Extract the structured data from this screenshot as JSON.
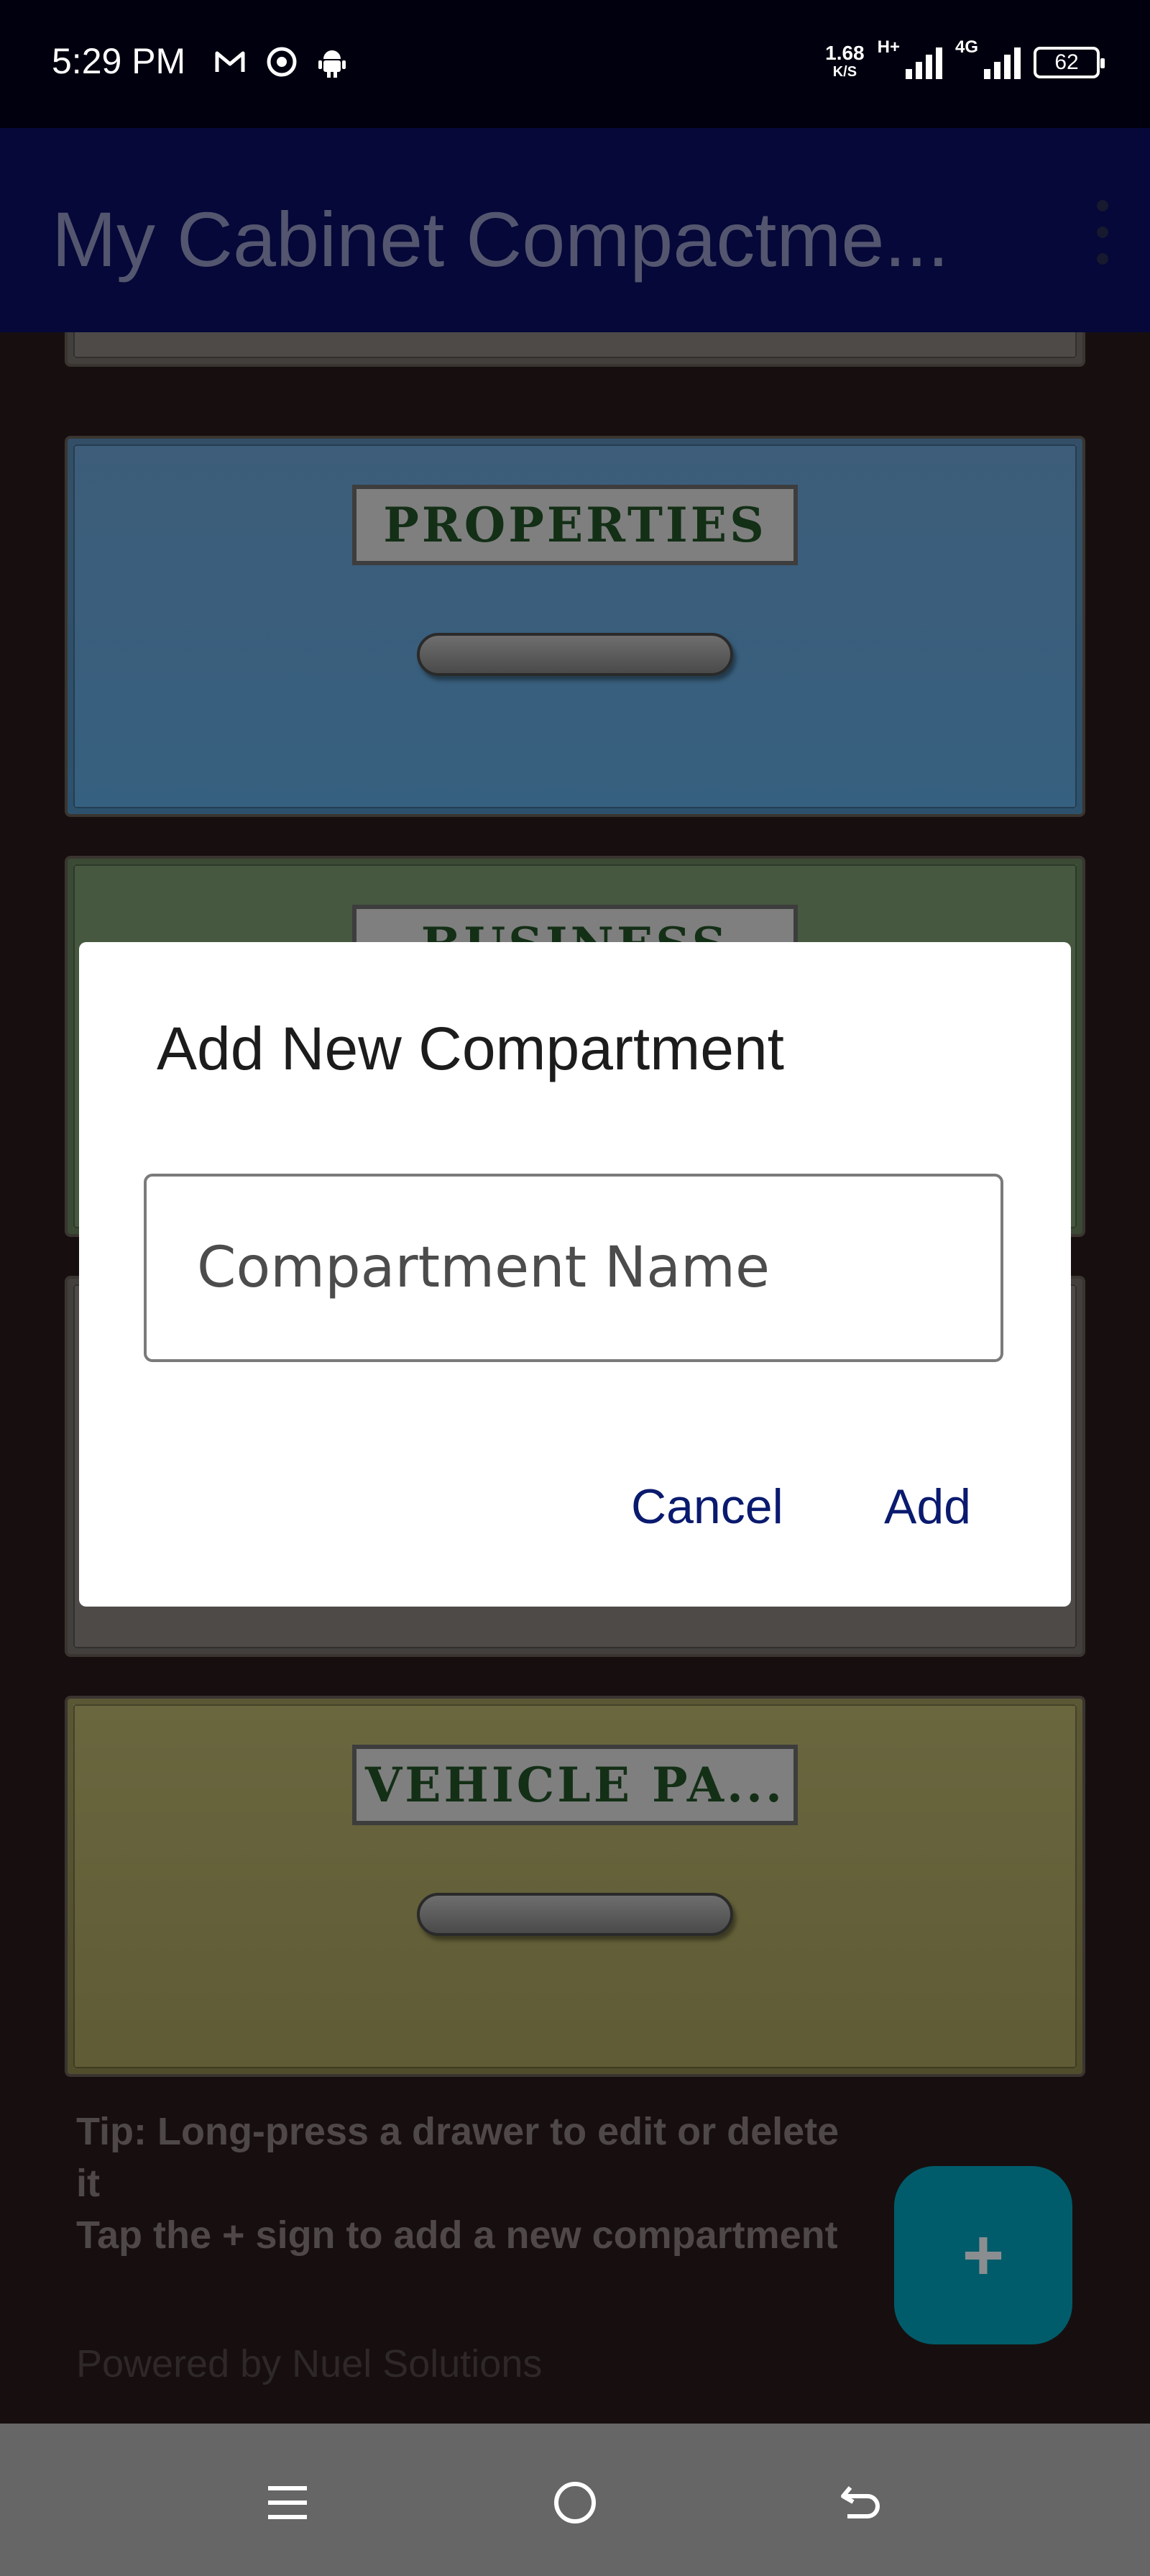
{
  "status_bar": {
    "time": "5:29 PM",
    "icons": [
      "gmail-icon",
      "chrome-icon",
      "android-icon"
    ],
    "net_speed": "1.68",
    "net_speed_unit": "K/S",
    "signal_1_label": "H+",
    "signal_2_label": "4G",
    "battery": "62"
  },
  "app_bar": {
    "title": "My Cabinet Compactme...",
    "overflow_icon": "more-vert-icon"
  },
  "drawers": [
    {
      "label": "",
      "color": "#6a6a6a"
    },
    {
      "label": "PROPERTIES",
      "color": "#4a7fae"
    },
    {
      "label": "BUSINESS",
      "color": "#5c7a58"
    },
    {
      "label": "",
      "color": "#6a6a6a"
    },
    {
      "label": "VEHICLE PA...",
      "color": "#8a8444"
    }
  ],
  "tips": {
    "line1": "Tip: Long-press a drawer to edit or delete it",
    "line2": "Tap the + sign to add a new compartment",
    "powered_by": "Powered by Nuel Solutions"
  },
  "fab": {
    "icon": "+",
    "color": "#005c6b"
  },
  "dialog": {
    "title": "Add New Compartment",
    "input_placeholder": "Compartment Name",
    "input_value": "",
    "cancel_label": "Cancel",
    "add_label": "Add",
    "accent_color": "#0a1a6e"
  },
  "nav_bar": {
    "icons": [
      "menu-icon",
      "home-circle-icon",
      "back-icon"
    ]
  }
}
